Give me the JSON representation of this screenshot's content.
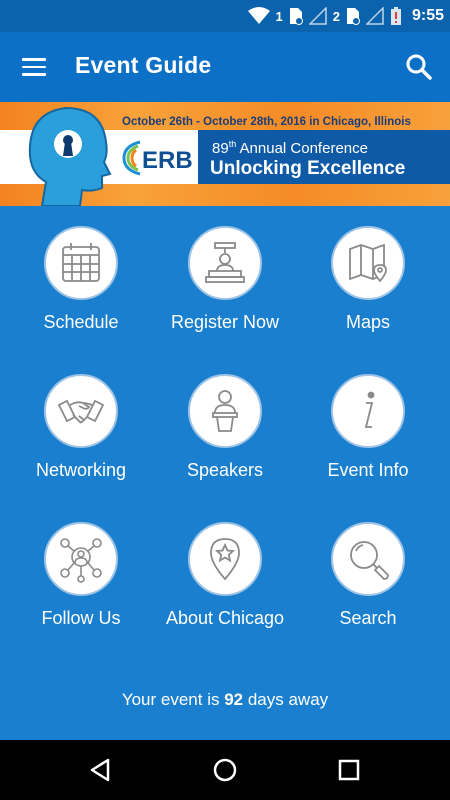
{
  "status_bar": {
    "sim1_label": "1",
    "sim2_label": "2",
    "time": "9:55"
  },
  "app_bar": {
    "title": "Event Guide",
    "menu_icon": "hamburger-menu-icon",
    "search_icon": "search-icon"
  },
  "banner": {
    "dates": "October 26th - October 28th, 2016 in Chicago, Illinois",
    "org": "ERB",
    "conference_prefix": "89",
    "conference_suffix": "th",
    "conference_rest": " Annual Conference",
    "tagline": "Unlocking Excellence"
  },
  "tiles": [
    {
      "label": "Schedule",
      "icon": "calendar-icon"
    },
    {
      "label": "Register Now",
      "icon": "registration-desk-icon"
    },
    {
      "label": "Maps",
      "icon": "map-icon"
    },
    {
      "label": "Networking",
      "icon": "handshake-icon"
    },
    {
      "label": "Speakers",
      "icon": "podium-speaker-icon"
    },
    {
      "label": "Event Info",
      "icon": "info-icon"
    },
    {
      "label": "Follow Us",
      "icon": "social-network-icon"
    },
    {
      "label": "About Chicago",
      "icon": "location-star-icon"
    },
    {
      "label": "Search",
      "icon": "magnifier-icon"
    }
  ],
  "countdown": {
    "prefix": "Your event is ",
    "days": "92",
    "suffix": " days away"
  },
  "colors": {
    "background": "#1b7fd0",
    "app_bar": "#0c71c6",
    "status_bar": "#0c63ad",
    "banner_orange": "#f3821f",
    "banner_blue": "#0f5aa6"
  }
}
